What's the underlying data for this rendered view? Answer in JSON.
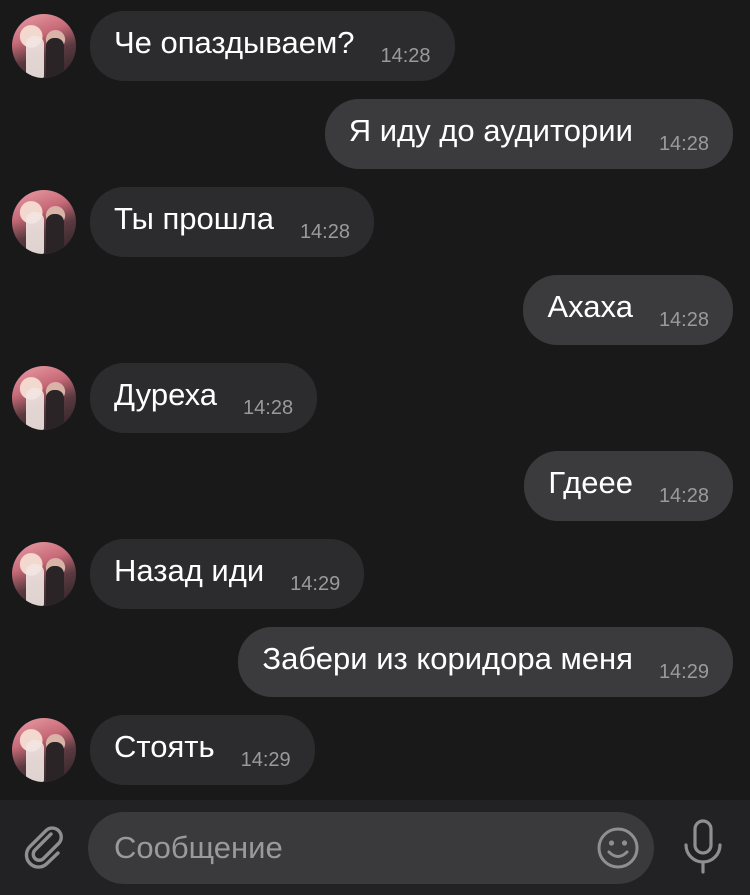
{
  "messages": [
    {
      "text": "Че опаздываем?",
      "time": "14:28",
      "direction": "in"
    },
    {
      "text": "Я иду до аудитории",
      "time": "14:28",
      "direction": "out"
    },
    {
      "text": "Ты прошла",
      "time": "14:28",
      "direction": "in"
    },
    {
      "text": "Ахаха",
      "time": "14:28",
      "direction": "out"
    },
    {
      "text": "Дуреха",
      "time": "14:28",
      "direction": "in"
    },
    {
      "text": "Гдеее",
      "time": "14:28",
      "direction": "out"
    },
    {
      "text": "Назад иди",
      "time": "14:29",
      "direction": "in"
    },
    {
      "text": "Забери из коридора меня",
      "time": "14:29",
      "direction": "out"
    },
    {
      "text": "Стоять",
      "time": "14:29",
      "direction": "in"
    }
  ],
  "input": {
    "placeholder": "Сообщение",
    "value": ""
  },
  "icons": {
    "attach": "paperclip-icon",
    "emoji": "smiley-icon",
    "mic": "microphone-icon"
  },
  "colors": {
    "background": "#19191a",
    "incoming_bubble": "#2c2c2e",
    "outgoing_bubble": "#3b3b3d",
    "timestamp": "#9a9a9e"
  }
}
